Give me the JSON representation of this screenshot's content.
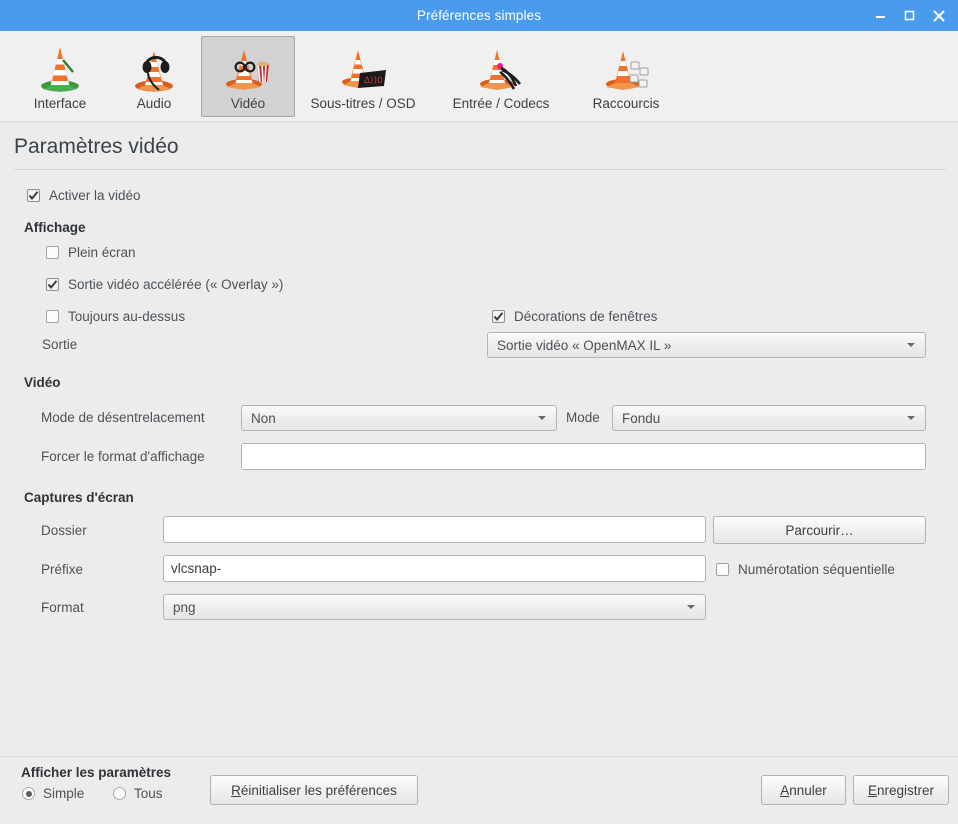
{
  "window": {
    "title": "Préférences simples",
    "controls": [
      {
        "name": "minimize",
        "glyph": "minimize-icon"
      },
      {
        "name": "maximize",
        "glyph": "maximize-icon"
      },
      {
        "name": "close",
        "glyph": "close-icon"
      }
    ]
  },
  "toolbar": {
    "tabs": [
      {
        "label": "Interface",
        "icon": "vlc-cone-interface-icon",
        "selected": false
      },
      {
        "label": "Audio",
        "icon": "vlc-cone-headphones-icon",
        "selected": false
      },
      {
        "label": "Vidéo",
        "icon": "vlc-cone-video-icon",
        "selected": true
      },
      {
        "label": "Sous-titres / OSD",
        "icon": "vlc-cone-subtitles-icon",
        "selected": false
      },
      {
        "label": "Entrée / Codecs",
        "icon": "vlc-cone-codecs-icon",
        "selected": false
      },
      {
        "label": "Raccourcis",
        "icon": "vlc-cone-hotkeys-icon",
        "selected": false
      }
    ]
  },
  "page": {
    "heading": "Paramètres vidéo"
  },
  "video": {
    "enable_label": "Activer la vidéo",
    "enable_checked": true
  },
  "display": {
    "group_title": "Affichage",
    "fullscreen_label": "Plein écran",
    "fullscreen_checked": false,
    "overlay_label": "Sortie vidéo accélérée (« Overlay »)",
    "overlay_checked": true,
    "always_on_top_label": "Toujours au-dessus",
    "always_on_top_checked": false,
    "window_decorations_label": "Décorations de fenêtres",
    "window_decorations_checked": true,
    "output_label": "Sortie",
    "output_value": "Sortie vidéo « OpenMAX IL »"
  },
  "video_section": {
    "group_title": "Vidéo",
    "deinterlace_label": "Mode de désentrelacement",
    "deinterlace_value": "Non",
    "mode_label": "Mode",
    "mode_value": "Fondu",
    "aspect_label": "Forcer le format d'affichage",
    "aspect_value": "",
    "aspect_placeholder": ""
  },
  "screenshots": {
    "group_title": "Captures d'écran",
    "folder_label": "Dossier",
    "folder_value": "",
    "folder_placeholder": "",
    "browse_label": "Parcourir…",
    "prefix_label": "Préfixe",
    "prefix_value": "vlcsnap-",
    "sequential_label": "Numérotation séquentielle",
    "sequential_checked": false,
    "format_label": "Format",
    "format_value": "png"
  },
  "footer": {
    "show_settings_label": "Afficher les paramètres",
    "simple_label": "Simple",
    "simple_selected": true,
    "all_label": "Tous",
    "all_selected": false,
    "reset_label_accel": "R",
    "reset_label_rest": "éinitialiser les préférences",
    "cancel_label_accel": "A",
    "cancel_label_rest": "nnuler",
    "save_label_accel": "E",
    "save_label_rest": "nregistrer"
  },
  "colors": {
    "titlebar": "#4a9bec",
    "background": "#ececec",
    "toolbar": "#f0f0f0",
    "selected_tab": "#d2d2d2"
  }
}
